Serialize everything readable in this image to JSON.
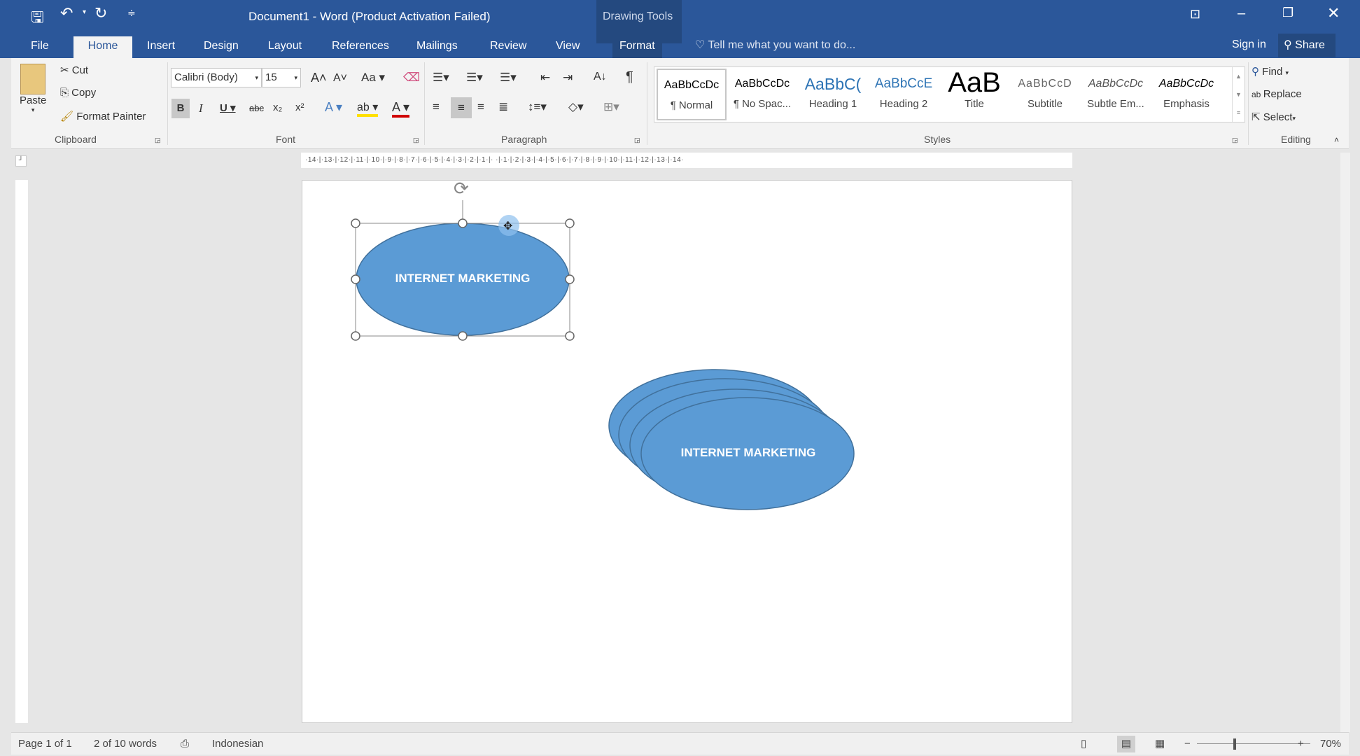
{
  "titlebar": {
    "title": "Document1 - Word (Product Activation Failed)",
    "context_group": "Drawing Tools"
  },
  "tabs": [
    {
      "label": "File"
    },
    {
      "label": "Home"
    },
    {
      "label": "Insert"
    },
    {
      "label": "Design"
    },
    {
      "label": "Layout"
    },
    {
      "label": "References"
    },
    {
      "label": "Mailings"
    },
    {
      "label": "Review"
    },
    {
      "label": "View"
    },
    {
      "label": "Format"
    }
  ],
  "tell_me": "Tell me what you want to do...",
  "sign_in": "Sign in",
  "share": "Share",
  "clipboard": {
    "paste": "Paste",
    "cut": "Cut",
    "copy": "Copy",
    "format_painter": "Format Painter",
    "label": "Clipboard"
  },
  "font": {
    "name": "Calibri (Body)",
    "size": "15",
    "label": "Font",
    "case": "Aa"
  },
  "paragraph": {
    "label": "Paragraph"
  },
  "styles": {
    "label": "Styles",
    "items": [
      {
        "preview": "AaBbCcDc",
        "name": "¶ Normal"
      },
      {
        "preview": "AaBbCcDc",
        "name": "¶ No Spac..."
      },
      {
        "preview": "AaBbC(",
        "name": "Heading 1"
      },
      {
        "preview": "AaBbCcE",
        "name": "Heading 2"
      },
      {
        "preview": "AaB",
        "name": "Title"
      },
      {
        "preview": "AaBbCcD",
        "name": "Subtitle"
      },
      {
        "preview": "AaBbCcDc",
        "name": "Subtle Em..."
      },
      {
        "preview": "AaBbCcDc",
        "name": "Emphasis"
      }
    ]
  },
  "editing": {
    "find": "Find",
    "replace": "Replace",
    "select": "Select",
    "label": "Editing"
  },
  "ruler": "·14·|·13·|·12·|·11·|·10·|·9·|·8·|·7·|·6·|·5·|·4·|·3·|·2·|·1·|·  ·|·1·|·2·|·3·|·4·|·5·|·6·|·7·|·8·|·9·|·10·|·11·|·12·|·13·|·14·",
  "document": {
    "shape1_text": "INTERNET MARKETING",
    "shape2_text": "INTERNET MARKETING",
    "shape_color": "#5b9bd5",
    "shape_border": "#41719c"
  },
  "status": {
    "page": "Page 1 of 1",
    "words": "2 of 10 words",
    "language": "Indonesian",
    "zoom": "70%"
  },
  "zoom_level": 70
}
